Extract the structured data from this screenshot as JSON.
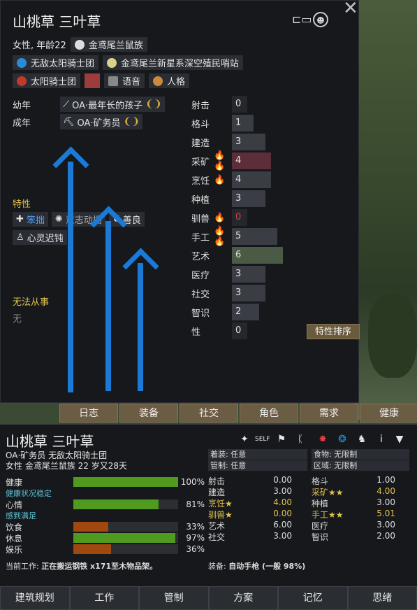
{
  "window": {
    "title": "山桃草 三叶草",
    "close": "✕"
  },
  "header": {
    "gender_age": "女性, 年龄22",
    "xenotype": "金鸢尾兰鼠族",
    "faction1": "无敌太阳骑士团",
    "homeworld": "金鸢尾兰新星系深空殖民哨站",
    "faction2": "太阳骑士团",
    "voice": "语音",
    "persona": "人格",
    "color_swatch": "#9c3c3c"
  },
  "backstory": {
    "childhood_label": "幼年",
    "childhood": "OA·最年长的孩子",
    "adulthood_label": "成年",
    "adulthood": "OA·矿务员"
  },
  "traits": {
    "label": "特性",
    "items": [
      "笨拙",
      "意志动摇",
      "善良",
      "心灵迟钝"
    ]
  },
  "incapable": {
    "label": "无法从事",
    "value": "无"
  },
  "skills": [
    {
      "name": "射击",
      "level": "0",
      "passion": "",
      "fill": 0,
      "color": "#24272c"
    },
    {
      "name": "格斗",
      "level": "1",
      "passion": "",
      "fill": 0.05,
      "color": "#3a3d44"
    },
    {
      "name": "建造",
      "level": "3",
      "passion": "",
      "fill": 0.15,
      "color": "#3a3d44"
    },
    {
      "name": "采矿",
      "level": "4",
      "passion": "🔥🔥",
      "fill": 0.2,
      "color": "#5c2e3a"
    },
    {
      "name": "烹饪",
      "level": "4",
      "passion": "🔥",
      "fill": 0.2,
      "color": "#3a3d44"
    },
    {
      "name": "种植",
      "level": "3",
      "passion": "",
      "fill": 0.15,
      "color": "#3a3d44"
    },
    {
      "name": "驯兽",
      "level": "0",
      "passion": "🔥",
      "fill": 0,
      "color": "#24272c"
    },
    {
      "name": "手工",
      "level": "5",
      "passion": "🔥🔥",
      "fill": 0.25,
      "color": "#3a3d44"
    },
    {
      "name": "艺术",
      "level": "6",
      "passion": "",
      "fill": 0.3,
      "color": "#4a5a44"
    },
    {
      "name": "医疗",
      "level": "3",
      "passion": "",
      "fill": 0.15,
      "color": "#3a3d44"
    },
    {
      "name": "社交",
      "level": "3",
      "passion": "",
      "fill": 0.15,
      "color": "#3a3d44"
    },
    {
      "name": "智识",
      "level": "2",
      "passion": "",
      "fill": 0.1,
      "color": "#3a3d44"
    },
    {
      "name": "性",
      "level": "0",
      "passion": "",
      "fill": 0,
      "color": "#24272c"
    }
  ],
  "sort_button": "特性排序",
  "tabs": [
    "日志",
    "装备",
    "社交",
    "角色",
    "需求",
    "健康"
  ],
  "inspect": {
    "name": "山桃草 三叶草",
    "line1": "OA·矿务员 无敌太阳骑士团",
    "line2": "女性 金鸢尾兰鼠族 22 岁又28天",
    "apparel": "着装: 任意",
    "food": "食物: 无限制",
    "manage": "管制: 任意",
    "area": "区域: 无限制",
    "needs": [
      {
        "name": "健康",
        "pct": "100%",
        "fill": 1.0,
        "color": "#4f9a1f"
      },
      {
        "name": "心情",
        "pct": "81%",
        "fill": 0.81,
        "color": "#4f9a1f"
      },
      {
        "name": "饮食",
        "pct": "33%",
        "fill": 0.33,
        "color": "#a0480f"
      },
      {
        "name": "休息",
        "pct": "97%",
        "fill": 0.97,
        "color": "#4f9a1f"
      },
      {
        "name": "娱乐",
        "pct": "36%",
        "fill": 0.36,
        "color": "#a0480f"
      }
    ],
    "health_status": "健康状况稳定",
    "mood_status": "感到满足",
    "skills_left": [
      {
        "k": "射击",
        "v": "0.00"
      },
      {
        "k": "建造",
        "v": "3.00"
      },
      {
        "k": "烹饪★",
        "v": "4.00"
      },
      {
        "k": "驯兽★",
        "v": "0.00"
      },
      {
        "k": "艺术",
        "v": "6.00"
      },
      {
        "k": "社交",
        "v": "3.00"
      }
    ],
    "skills_right": [
      {
        "k": "格斗",
        "v": "1.00"
      },
      {
        "k": "采矿★★",
        "v": "4.00"
      },
      {
        "k": "种植",
        "v": "3.00"
      },
      {
        "k": "手工★★",
        "v": "5.01"
      },
      {
        "k": "医疗",
        "v": "3.00"
      },
      {
        "k": "智识",
        "v": "2.00"
      }
    ],
    "job_label": "当前工作:",
    "job": "正在搬运钢铁 x171至木物品架。",
    "equip_label": "装备:",
    "equip": "自动手枪 (一般 98%)"
  },
  "bottom_tabs": [
    "建筑规划",
    "工作",
    "管制",
    "方案",
    "记忆",
    "思绪"
  ]
}
